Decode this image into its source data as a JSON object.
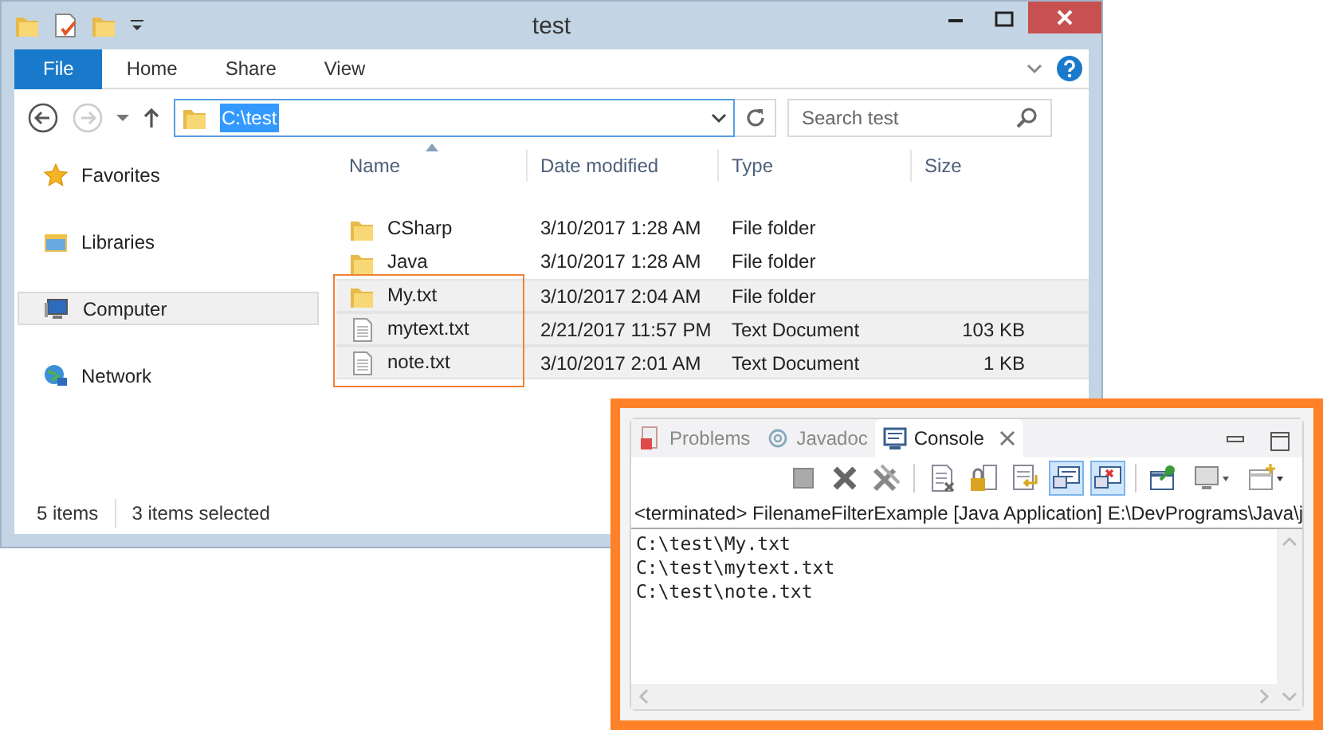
{
  "explorer": {
    "title": "test",
    "ribbon_tabs": [
      {
        "label": "File",
        "selected": true
      },
      {
        "label": "Home",
        "selected": false
      },
      {
        "label": "Share",
        "selected": false
      },
      {
        "label": "View",
        "selected": false
      }
    ],
    "address": "C:\\test",
    "search": {
      "placeholder": "Search test"
    },
    "nav": [
      {
        "label": "Favorites",
        "selected": false
      },
      {
        "label": "Libraries",
        "selected": false
      },
      {
        "label": "Computer",
        "selected": true
      },
      {
        "label": "Network",
        "selected": false
      }
    ],
    "columns": [
      "Name",
      "Date modified",
      "Type",
      "Size"
    ],
    "files": [
      {
        "name": "CSharp",
        "kind": "folder",
        "date": "3/10/2017 1:28 AM",
        "type": "File folder",
        "selected": false,
        "outlined": false
      },
      {
        "name": "Java",
        "kind": "folder",
        "date": "3/10/2017 1:28 AM",
        "type": "File folder",
        "selected": false,
        "outlined": false
      },
      {
        "name": "My.txt",
        "kind": "folder",
        "date": "3/10/2017 2:04 AM",
        "type": "File folder",
        "selected": true,
        "outlined": true
      },
      {
        "name": "mytext.txt",
        "kind": "text",
        "date": "2/21/2017 11:57 PM",
        "type": "Text Document",
        "size": "103 KB",
        "selected": true,
        "outlined": true
      },
      {
        "name": "note.txt",
        "kind": "text",
        "date": "3/10/2017 2:01 AM",
        "type": "Text Document",
        "size": "1 KB",
        "selected": true,
        "outlined": true
      }
    ],
    "status": [
      "5 items",
      "3 items selected"
    ]
  },
  "console": {
    "tabs": [
      {
        "label": "Problems",
        "selected": false
      },
      {
        "label": "Javadoc",
        "selected": false
      },
      {
        "label": "Console",
        "selected": true
      }
    ],
    "toolbar": [
      {
        "pressed": false
      },
      {
        "pressed": false
      },
      {
        "pressed": false
      },
      {
        "pressed": false
      },
      {
        "pressed": false
      },
      {
        "pressed": false
      },
      {
        "pressed": true
      },
      {
        "pressed": true
      },
      {
        "pressed": false
      },
      {
        "pressed": false
      },
      {
        "pressed": false
      }
    ],
    "launch": "<terminated> FilenameFilterExample [Java Application] E:\\DevPrograms\\Java\\j",
    "lines": [
      "C:\\test\\My.txt",
      "C:\\test\\mytext.txt",
      "C:\\test\\note.txt"
    ]
  }
}
